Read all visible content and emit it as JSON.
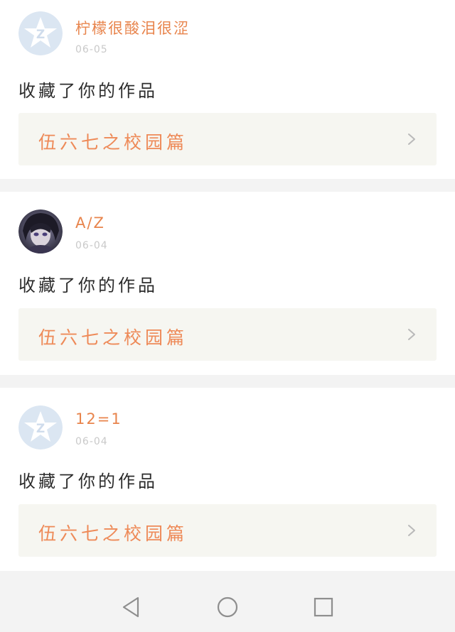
{
  "feed": [
    {
      "username": "柠檬很酸泪很涩",
      "date": "06-05",
      "avatar_icon": "default-qq-star-icon",
      "action": "收藏了你的作品",
      "work_title": "伍六七之校园篇"
    },
    {
      "username": "A/Z",
      "date": "06-04",
      "avatar_icon": "anime-character-avatar",
      "action": "收藏了你的作品",
      "work_title": "伍六七之校园篇"
    },
    {
      "username": "12=1",
      "date": "06-04",
      "avatar_icon": "default-qq-star-icon",
      "action": "收藏了你的作品",
      "work_title": "伍六七之校园篇"
    }
  ],
  "navbar": {
    "back_icon": "triangle-back-icon",
    "home_icon": "circle-home-icon",
    "recent_icon": "square-recents-icon"
  },
  "colors": {
    "username": "#e8844c",
    "work_title": "#ee8a58",
    "link_bg": "#f6f6f1",
    "divider_bg": "#f3f3f3",
    "date": "#c9c9c9"
  }
}
